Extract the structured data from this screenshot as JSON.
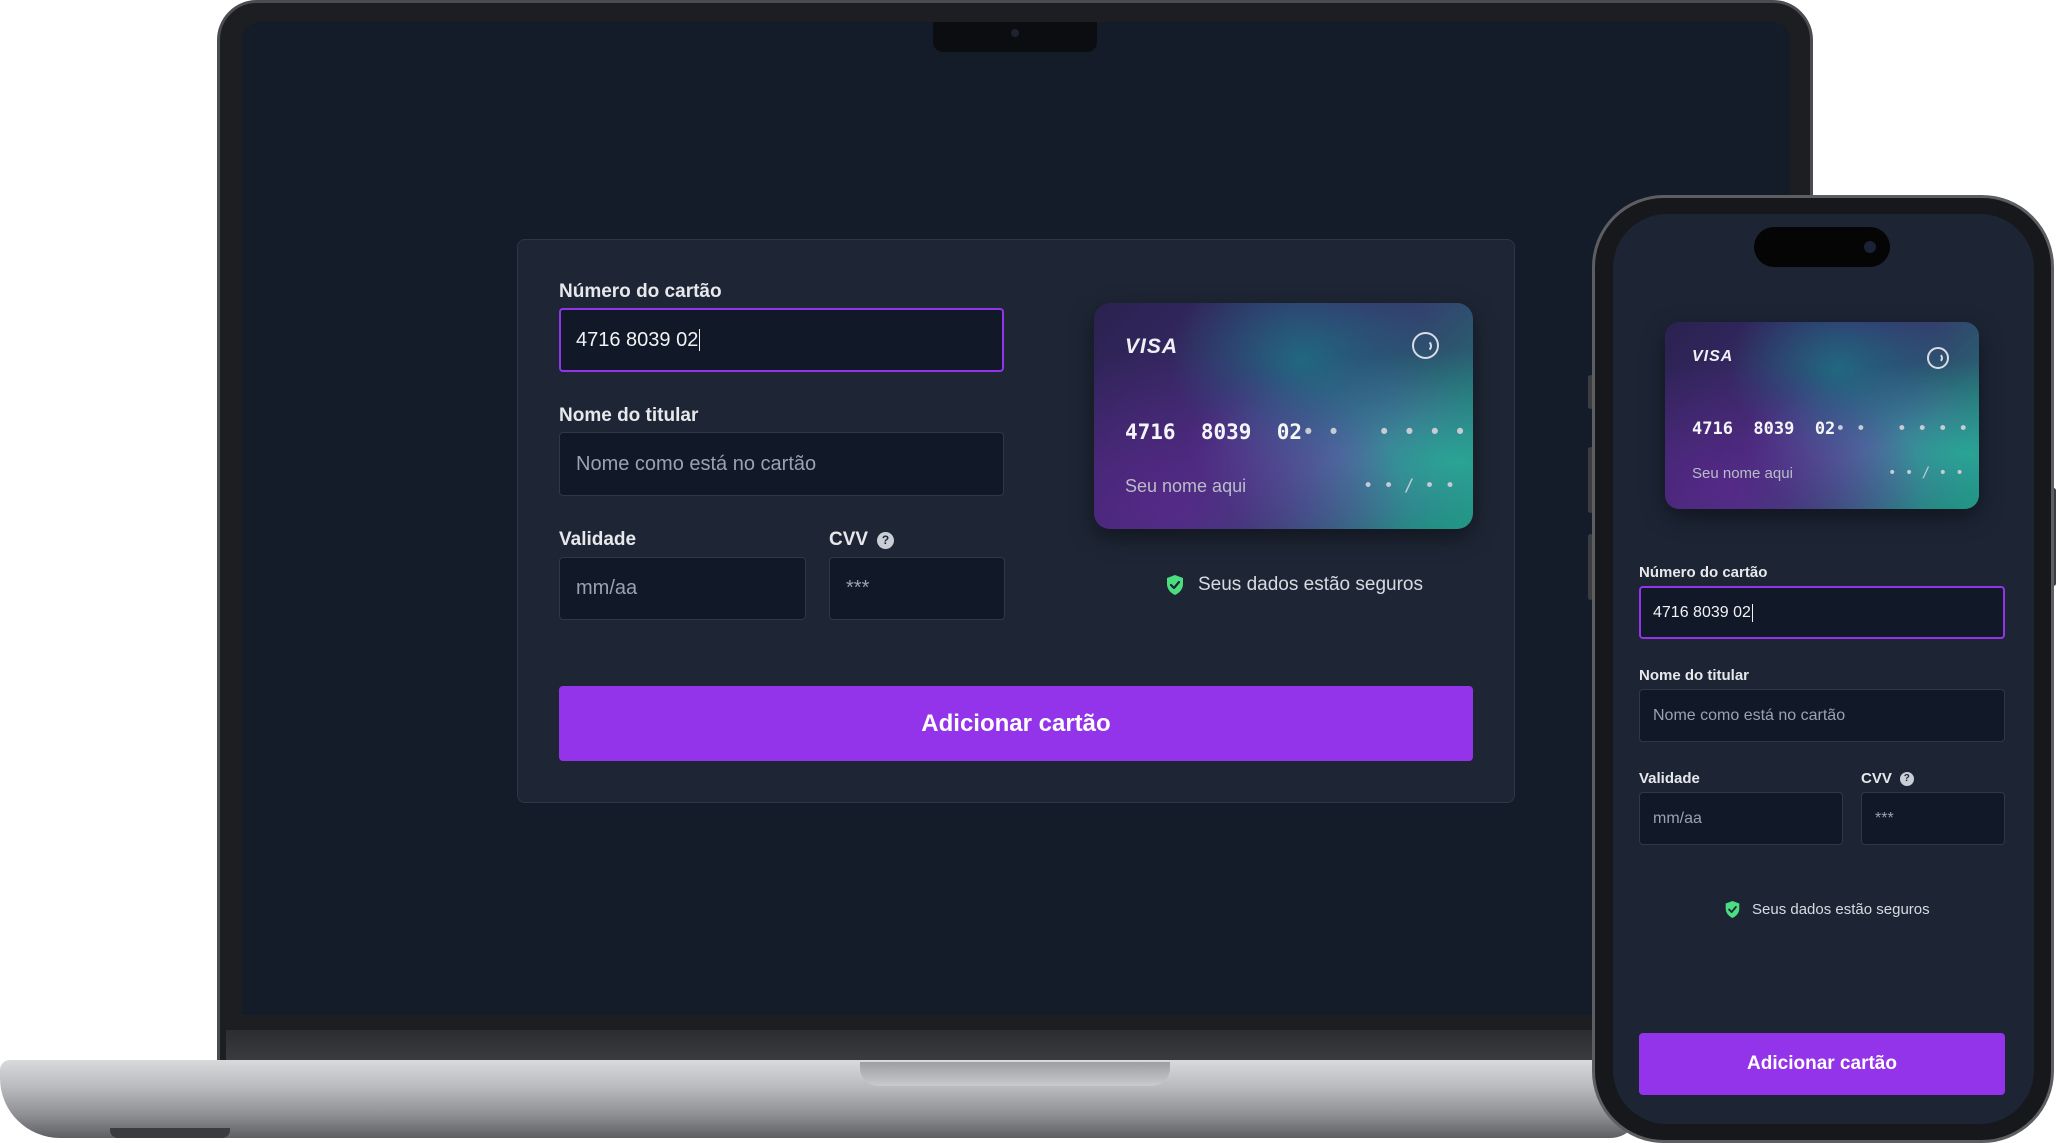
{
  "desktop": {
    "card_number_label": "Número do cartão",
    "card_number_value": "4716 8039 02",
    "holder_label": "Nome do titular",
    "holder_placeholder": "Nome como está no cartão",
    "expiry_label": "Validade",
    "expiry_placeholder": "mm/aa",
    "cvv_label": "CVV",
    "cvv_placeholder": "***",
    "help_glyph": "?",
    "submit_label": "Adicionar cartão",
    "secure_text": "Seus dados estão seguros",
    "card": {
      "brand": "VISA",
      "number_typed": "4716  8039  02",
      "number_mask": "• •   • • • •",
      "holder": "Seu nome aqui",
      "expiry": "• • / • •"
    }
  },
  "mobile": {
    "card_number_label": "Número do cartão",
    "card_number_value": "4716 8039 02",
    "holder_label": "Nome do titular",
    "holder_placeholder": "Nome como está no cartão",
    "expiry_label": "Validade",
    "expiry_placeholder": "mm/aa",
    "cvv_label": "CVV",
    "cvv_placeholder": "***",
    "help_glyph": "?",
    "submit_label": "Adicionar cartão",
    "secure_text": "Seus dados estão seguros",
    "card": {
      "brand": "VISA",
      "number_typed": "4716  8039  02",
      "number_mask": "• •   • • • •",
      "holder": "Seu nome aqui",
      "expiry": "• • / • •"
    }
  },
  "colors": {
    "accent": "#9333ea",
    "panel": "#1e2635",
    "screen": "#141b29",
    "input": "#111827",
    "secure_green": "#4ade80"
  },
  "icons": [
    "visa-logo",
    "contactless-icon",
    "help-icon",
    "shield-check-icon"
  ]
}
